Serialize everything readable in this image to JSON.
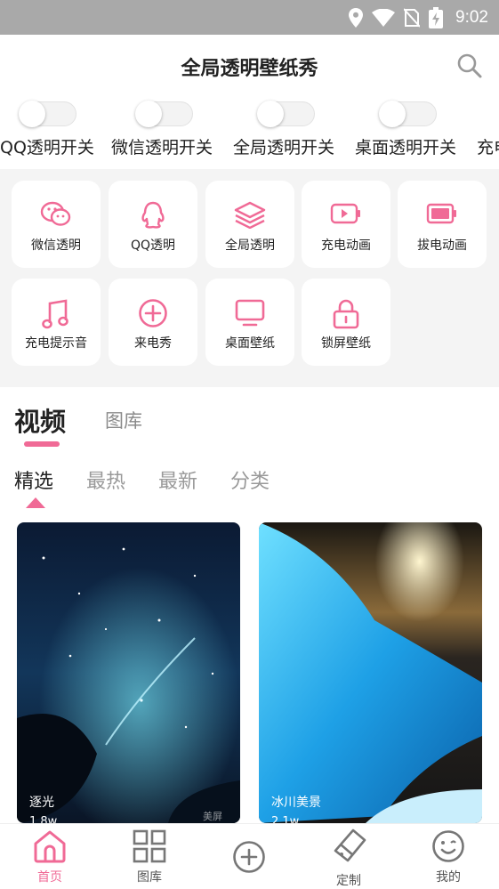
{
  "status_bar": {
    "time": "9:02"
  },
  "header": {
    "title": "全局透明壁纸秀"
  },
  "toggles": [
    {
      "label": "QQ透明开关",
      "on": false
    },
    {
      "label": "微信透明开关",
      "on": false
    },
    {
      "label": "全局透明开关",
      "on": false
    },
    {
      "label": "桌面透明开关",
      "on": false
    },
    {
      "label": "充电",
      "on": false
    }
  ],
  "features": [
    {
      "label": "微信透明",
      "icon": "wechat-icon"
    },
    {
      "label": "QQ透明",
      "icon": "qq-icon"
    },
    {
      "label": "全局透明",
      "icon": "layers-icon"
    },
    {
      "label": "充电动画",
      "icon": "charging-battery-icon"
    },
    {
      "label": "拔电动画",
      "icon": "battery-full-icon"
    },
    {
      "label": "充电提示音",
      "icon": "music-note-icon"
    },
    {
      "label": "来电秀",
      "icon": "plus-circle-icon"
    },
    {
      "label": "桌面壁纸",
      "icon": "monitor-icon"
    },
    {
      "label": "锁屏壁纸",
      "icon": "lock-icon"
    }
  ],
  "main_tabs": {
    "video": "视频",
    "gallery": "图库",
    "active": "视频"
  },
  "sub_tabs": {
    "items": [
      "精选",
      "最热",
      "最新",
      "分类"
    ],
    "active": "精选"
  },
  "cards": [
    {
      "title": "逐光",
      "meta": "1.8w",
      "watermark": "美屏"
    },
    {
      "title": "冰川美景",
      "meta": "2.1w",
      "watermark": ""
    }
  ],
  "bottom_nav": [
    {
      "label": "首页",
      "icon": "home-icon",
      "active": true
    },
    {
      "label": "图库",
      "icon": "grid-icon",
      "active": false
    },
    {
      "label": "",
      "icon": "add-circle-icon",
      "active": false
    },
    {
      "label": "定制",
      "icon": "brush-icon",
      "active": false
    },
    {
      "label": "我的",
      "icon": "face-icon",
      "active": false
    }
  ],
  "colors": {
    "accent": "#f06a96",
    "status_bar": "#a9a9a9",
    "grid_bg": "#f4f4f4"
  }
}
